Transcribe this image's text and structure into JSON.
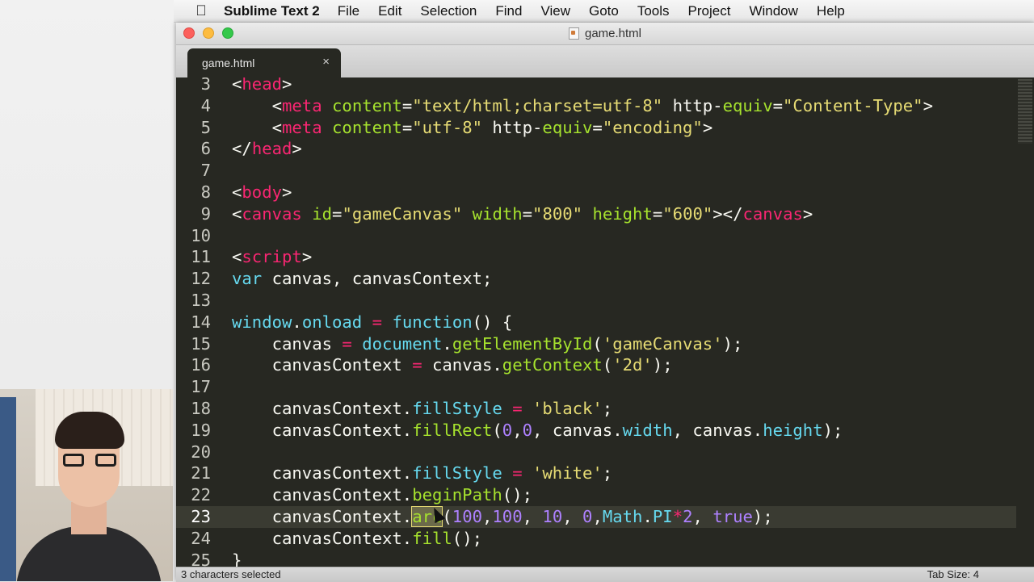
{
  "menubar": {
    "app_name": "Sublime Text 2",
    "items": [
      "File",
      "Edit",
      "Selection",
      "Find",
      "View",
      "Goto",
      "Tools",
      "Project",
      "Window",
      "Help"
    ]
  },
  "window": {
    "title": "game.html"
  },
  "tab": {
    "label": "game.html",
    "close_glyph": "×"
  },
  "status": {
    "left": "3 characters selected",
    "right": "Tab Size: 4"
  },
  "editor": {
    "active_line": 23,
    "selected_text": "arc",
    "lines": [
      {
        "n": "3",
        "text": "<head>"
      },
      {
        "n": "4",
        "text": "    <meta content=\"text/html;charset=utf-8\" http-equiv=\"Content-Type\">"
      },
      {
        "n": "5",
        "text": "    <meta content=\"utf-8\" http-equiv=\"encoding\">"
      },
      {
        "n": "6",
        "text": "</head>"
      },
      {
        "n": "7",
        "text": ""
      },
      {
        "n": "8",
        "text": "<body>"
      },
      {
        "n": "9",
        "text": "<canvas id=\"gameCanvas\" width=\"800\" height=\"600\"></canvas>"
      },
      {
        "n": "10",
        "text": ""
      },
      {
        "n": "11",
        "text": "<script>"
      },
      {
        "n": "12",
        "text": "var canvas, canvasContext;"
      },
      {
        "n": "13",
        "text": ""
      },
      {
        "n": "14",
        "text": "window.onload = function() {"
      },
      {
        "n": "15",
        "text": "    canvas = document.getElementById('gameCanvas');"
      },
      {
        "n": "16",
        "text": "    canvasContext = canvas.getContext('2d');"
      },
      {
        "n": "17",
        "text": ""
      },
      {
        "n": "18",
        "text": "    canvasContext.fillStyle = 'black';"
      },
      {
        "n": "19",
        "text": "    canvasContext.fillRect(0,0, canvas.width, canvas.height);"
      },
      {
        "n": "20",
        "text": ""
      },
      {
        "n": "21",
        "text": "    canvasContext.fillStyle = 'white';"
      },
      {
        "n": "22",
        "text": "    canvasContext.beginPath();"
      },
      {
        "n": "23",
        "text": "    canvasContext.arc(100,100, 10, 0,Math.PI*2, true);"
      },
      {
        "n": "24",
        "text": "    canvasContext.fill();"
      },
      {
        "n": "25",
        "text": "}"
      }
    ]
  }
}
